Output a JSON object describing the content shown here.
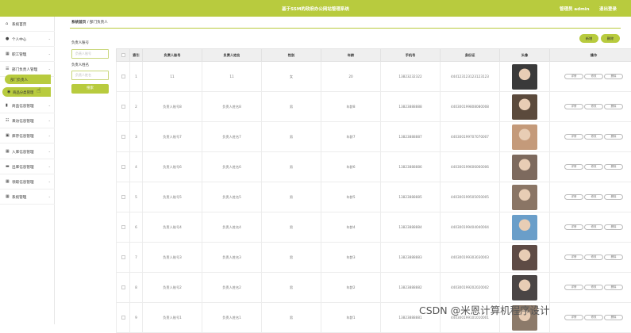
{
  "header": {
    "title": "基于SSM的政府办公网站管理系统",
    "user": "管理员 admin",
    "logout": "退出登录"
  },
  "sidebar": {
    "items": [
      {
        "label": "系统首页",
        "icon": "home-icon",
        "glyph": "⌂"
      },
      {
        "label": "个人中心",
        "icon": "person-icon",
        "glyph": "●"
      },
      {
        "label": "职工管理",
        "icon": "grid-icon",
        "glyph": "▦"
      },
      {
        "label": "部门负责人管理",
        "icon": "list-icon",
        "glyph": "☰"
      }
    ],
    "active_sub": "部门负责人",
    "hover_item": {
      "label": "商品分类管理",
      "glyph": "◉"
    },
    "items_after": [
      {
        "label": "商品信息管理",
        "icon": "bar-chart-icon",
        "glyph": "▮"
      },
      {
        "label": "来访信息管理",
        "icon": "sliders-icon",
        "glyph": "☷"
      },
      {
        "label": "库存信息管理",
        "icon": "box-icon",
        "glyph": "▣"
      },
      {
        "label": "入库信息管理",
        "icon": "grid-icon",
        "glyph": "▦"
      },
      {
        "label": "出库信息管理",
        "icon": "monitor-icon",
        "glyph": "▬"
      },
      {
        "label": "领取信息管理",
        "icon": "grid-icon",
        "glyph": "▦"
      },
      {
        "label": "系统管理",
        "icon": "grid-icon",
        "glyph": "▦"
      }
    ]
  },
  "breadcrumb": {
    "home": "系统首页",
    "sep": "/",
    "current": "部门负责人"
  },
  "filters": {
    "account_label": "负责人账号",
    "account_placeholder": "负责人账号",
    "name_label": "负责人姓名",
    "name_placeholder": "负责人姓名",
    "search": "搜索"
  },
  "actions": {
    "add": "新增",
    "delete": "删除"
  },
  "table": {
    "headers": [
      "索引",
      "负责人账号",
      "负责人姓名",
      "性别",
      "年龄",
      "手机号",
      "身份证",
      "头像",
      "操作"
    ],
    "op_labels": {
      "detail": "详情",
      "edit": "修改",
      "delete": "删除"
    },
    "rows": [
      {
        "index": "1",
        "account": "11",
        "name": "11",
        "gender": "女",
        "age": "20",
        "phone": "13823232322",
        "idcard": "444123123123123123",
        "avatar_color": "#3a3a3a"
      },
      {
        "index": "2",
        "account": "负责人账号8",
        "name": "负责人姓名8",
        "gender": "男",
        "age": "年龄8",
        "phone": "13823888888",
        "idcard": "440300199808080008",
        "avatar_color": "#5b4a3c"
      },
      {
        "index": "3",
        "account": "负责人账号7",
        "name": "负责人姓名7",
        "gender": "男",
        "age": "年龄7",
        "phone": "13823888887",
        "idcard": "440300199707070007",
        "avatar_color": "#c49a7a"
      },
      {
        "index": "4",
        "account": "负责人账号6",
        "name": "负责人姓名6",
        "gender": "男",
        "age": "年龄6",
        "phone": "13823888886",
        "idcard": "440300199606060006",
        "avatar_color": "#7d6a5e"
      },
      {
        "index": "5",
        "account": "负责人账号5",
        "name": "负责人姓名5",
        "gender": "男",
        "age": "年龄5",
        "phone": "13823888885",
        "idcard": "440300199505050005",
        "avatar_color": "#8a7565"
      },
      {
        "index": "6",
        "account": "负责人账号4",
        "name": "负责人姓名4",
        "gender": "男",
        "age": "年龄4",
        "phone": "13823888884",
        "idcard": "440300199404040004",
        "avatar_color": "#6a9ec9"
      },
      {
        "index": "7",
        "account": "负责人账号3",
        "name": "负责人姓名3",
        "gender": "男",
        "age": "年龄3",
        "phone": "13823888883",
        "idcard": "440300199303030003",
        "avatar_color": "#5e4b45"
      },
      {
        "index": "8",
        "account": "负责人账号2",
        "name": "负责人姓名2",
        "gender": "男",
        "age": "年龄2",
        "phone": "13823888882",
        "idcard": "440300199202020002",
        "avatar_color": "#4a4545"
      },
      {
        "index": "9",
        "account": "负责人账号1",
        "name": "负责人姓名1",
        "gender": "男",
        "age": "年龄1",
        "phone": "13823888881",
        "idcard": "440300199101010001",
        "avatar_color": "#8c7a6a"
      }
    ]
  },
  "watermark": "CSDN @米恩计算机程序设计",
  "colors": {
    "accent": "#b8cb3e"
  }
}
